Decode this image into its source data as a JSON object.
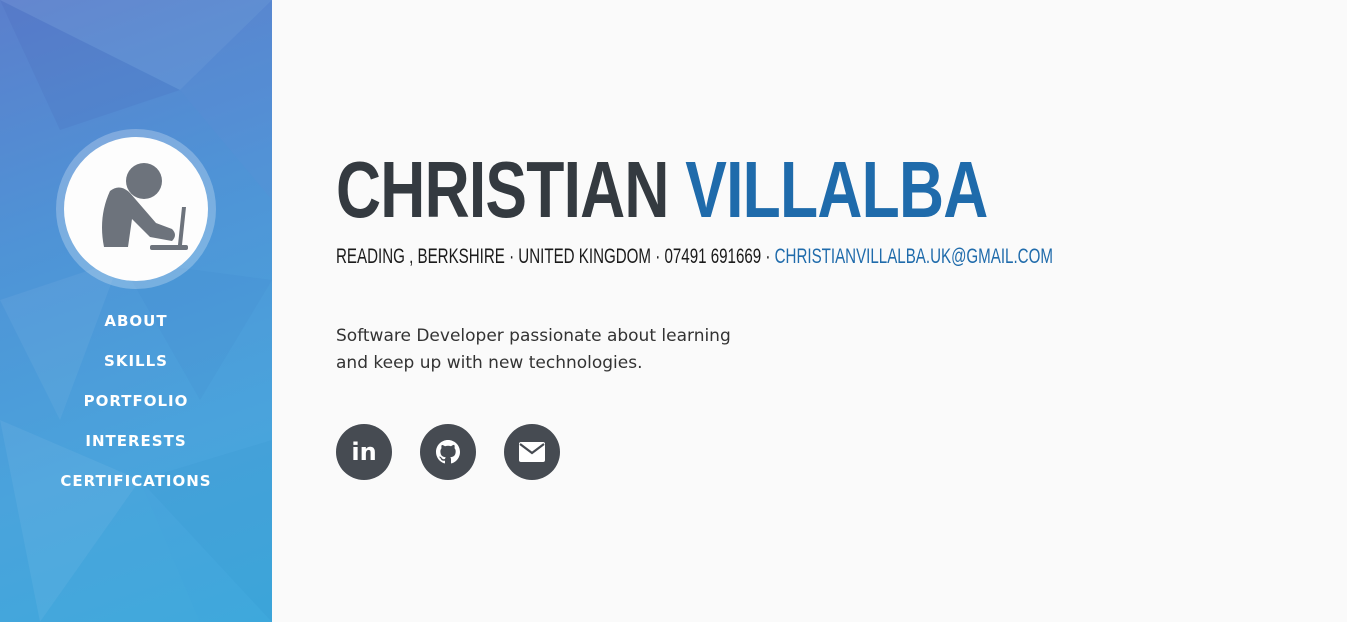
{
  "colors": {
    "accent": "#1f6bab",
    "dark": "#343a40",
    "sidebar_top": "#5b7fcc",
    "sidebar_bottom": "#3ea8dc",
    "social_bg": "#464b52"
  },
  "sidebar": {
    "avatar_icon": "person-at-laptop-icon",
    "nav": [
      {
        "label": "ABOUT"
      },
      {
        "label": "SKILLS"
      },
      {
        "label": "PORTFOLIO"
      },
      {
        "label": "INTERESTS"
      },
      {
        "label": "CERTIFICATIONS"
      }
    ]
  },
  "header": {
    "first_name": "CHRISTIAN",
    "last_name": "VILLALBA",
    "contact_text": "READING , BERKSHIRE · UNITED KINGDOM · 07491 691669 · ",
    "email": "CHRISTIANVILLALBA.UK@GMAIL.COM"
  },
  "bio": {
    "line1": "Software Developer passionate about learning",
    "line2": "and keep up with new technologies."
  },
  "social": [
    {
      "icon": "linkedin-icon",
      "text": "in"
    },
    {
      "icon": "github-icon"
    },
    {
      "icon": "envelope-icon"
    }
  ]
}
